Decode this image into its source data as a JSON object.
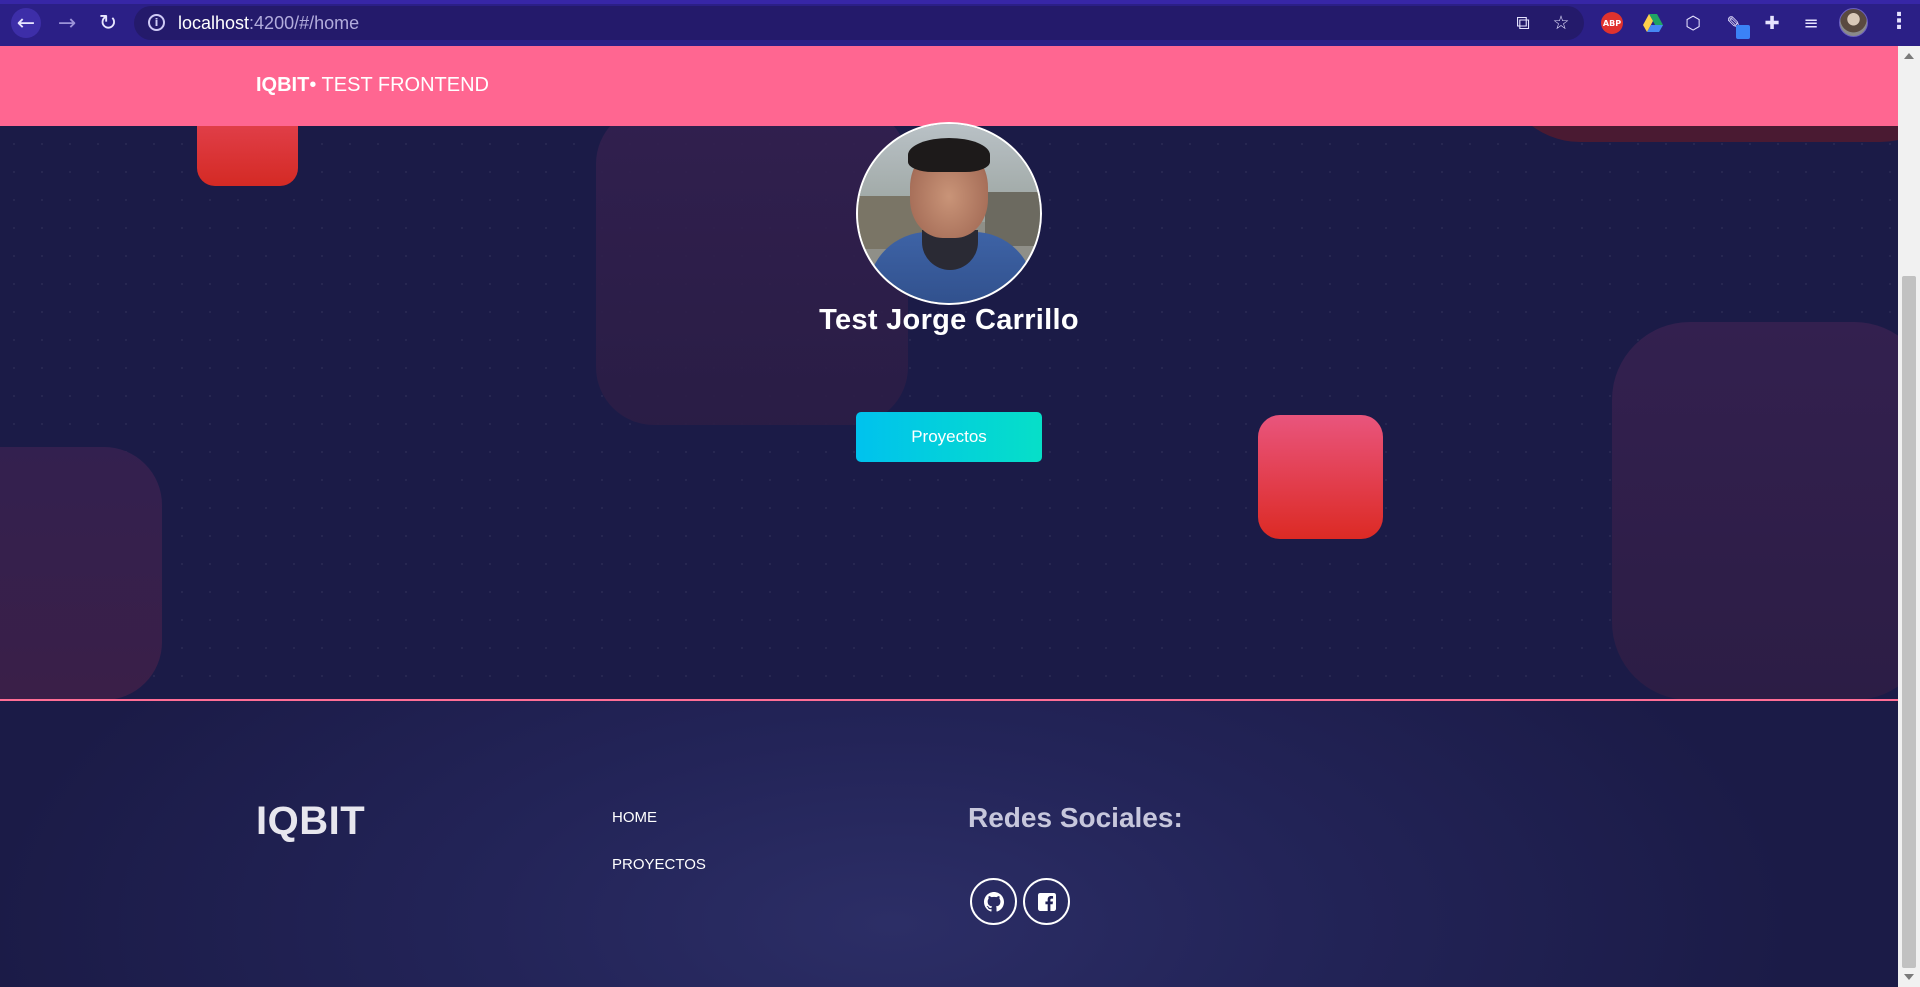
{
  "browser": {
    "url_host": "localhost",
    "url_rest": ":4200/#/home",
    "abp_label": "ABP"
  },
  "navbar": {
    "brand_strong": "IQBIT",
    "brand_rest": "• TEST FRONTEND"
  },
  "hero": {
    "name": "Test Jorge Carrillo",
    "projects_button": "Proyectos"
  },
  "footer": {
    "logo": "IQBIT",
    "links": [
      "HOME",
      "PROYECTOS"
    ],
    "social_title": "Redes Sociales:",
    "social_icons": [
      "github-icon",
      "facebook-icon"
    ]
  },
  "colors": {
    "navbar": "#ff6691",
    "page_bg": "#1b1b47",
    "accent_button": "#00c2ee",
    "divider": "#ff6e96"
  }
}
